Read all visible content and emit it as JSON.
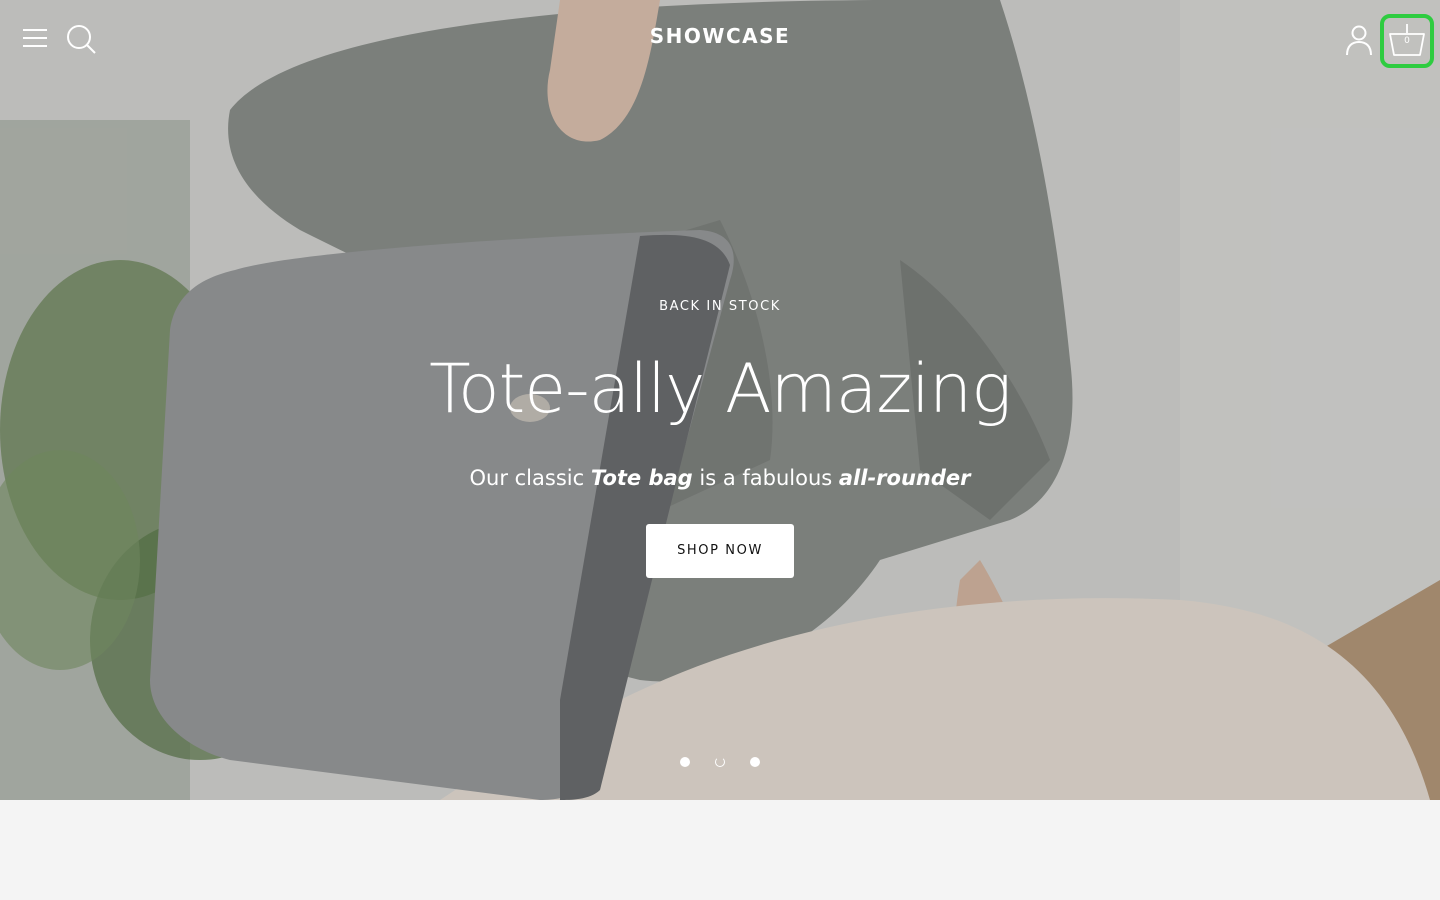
{
  "header": {
    "logo": "SHOWCASE",
    "menu_icon": "hamburger-menu-icon",
    "search_icon": "search-icon",
    "account_icon": "user-account-icon",
    "cart_icon": "shopping-basket-icon",
    "cart_count": "0"
  },
  "hero": {
    "eyebrow": "BACK IN STOCK",
    "headline": "Tote-ally Amazing",
    "subline_parts": {
      "p1": "Our classic ",
      "b1": "Tote bag",
      "p2": " is a fabulous ",
      "b2": "all-rounder"
    },
    "cta_label": "SHOP NOW",
    "slides": 3,
    "active_slide": 2
  },
  "colors": {
    "cart_highlight": "#2ecc40",
    "text_on_hero": "#ffffff",
    "cta_background": "#ffffff",
    "page_background": "#f4f4f4"
  }
}
